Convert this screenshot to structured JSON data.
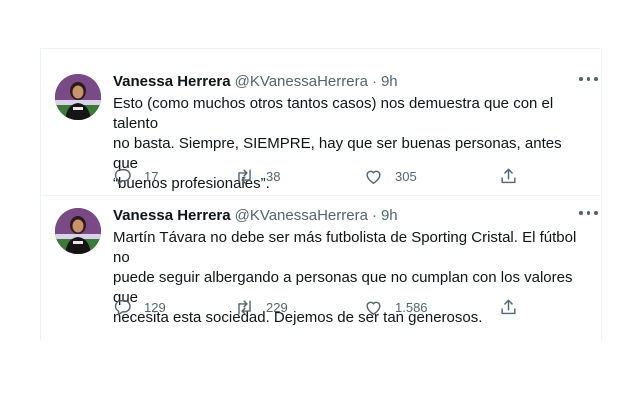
{
  "tweets": [
    {
      "name": "Vanessa Herrera",
      "handle": "@KVanessaHerrera",
      "separator": "·",
      "time": "9h",
      "text": "Esto (como muchos otros tantos casos) nos demuestra que con el talento\nno basta. Siempre, SIEMPRE, hay que ser buenas personas, antes que\n“buenos profesionales”.",
      "replies": "17",
      "retweets": "38",
      "likes": "305"
    },
    {
      "name": "Vanessa Herrera",
      "handle": "@KVanessaHerrera",
      "separator": "·",
      "time": "9h",
      "text": "Martín Távara no debe ser más futbolista de Sporting Cristal. El fútbol no\npuede seguir albergando a personas que no cumplan con los valores que\nnecesita esta sociedad. Dejemos de ser tan generosos.",
      "replies": "129",
      "retweets": "229",
      "likes": "1.586"
    }
  ],
  "icons": {
    "reply": "reply-icon",
    "retweet": "retweet-icon",
    "like": "heart-icon",
    "share": "share-icon",
    "more": "more-icon"
  },
  "colors": {
    "text": "#0f1419",
    "secondary": "#536471",
    "border": "#eff3f4"
  }
}
